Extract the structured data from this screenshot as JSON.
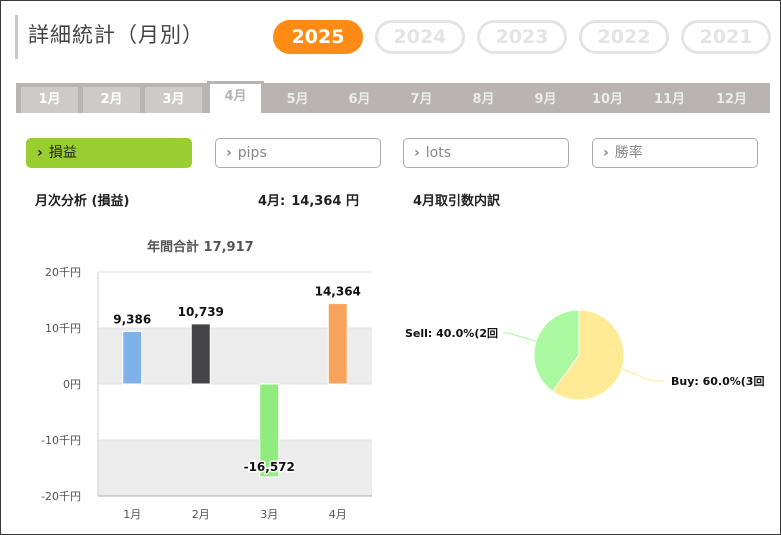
{
  "header": {
    "title": "詳細統計（月別）",
    "years": [
      "2025",
      "2024",
      "2023",
      "2022",
      "2021"
    ],
    "active_year": "2025"
  },
  "months": [
    "1月",
    "2月",
    "3月",
    "4月",
    "5月",
    "6月",
    "7月",
    "8月",
    "9月",
    "10月",
    "11月",
    "12月"
  ],
  "active_month_index": 3,
  "metrics": [
    {
      "label": "損益",
      "active": true
    },
    {
      "label": "pips",
      "active": false
    },
    {
      "label": "lots",
      "active": false
    },
    {
      "label": "勝率",
      "active": false
    }
  ],
  "metric_chevron": "›",
  "left_panel": {
    "heading": "月次分析 (損益)",
    "month_label": "4月:",
    "month_amount": "14,364 円",
    "annual_label": "年間合計 17,917"
  },
  "right_panel": {
    "heading": "4月取引数内訳"
  },
  "chart_data": [
    {
      "type": "bar",
      "title": "年間合計 17,917",
      "categories": [
        "1月",
        "2月",
        "3月",
        "4月"
      ],
      "values": [
        9386,
        10739,
        -16572,
        14364
      ],
      "value_labels": [
        "9,386",
        "10,739",
        "-16,572",
        "14,364"
      ],
      "colors": [
        "#7db3ea",
        "#434348",
        "#90ed7d",
        "#f7a35c"
      ],
      "ylim": [
        -20000,
        20000
      ],
      "yticks": [
        20000,
        10000,
        0,
        -10000,
        -20000
      ],
      "ytick_labels": [
        "20千円",
        "10千円",
        "0円",
        "-10千円",
        "-20千円"
      ],
      "band_fill": "#ececec"
    },
    {
      "type": "pie",
      "slices": [
        {
          "label": "Sell: 40.0%(2回",
          "value": 40.0,
          "color": "#aaf8a0",
          "line_color": "#aaf8a0"
        },
        {
          "label": "Buy: 60.0%(3回",
          "value": 60.0,
          "color": "#ffea96",
          "line_color": "#ffea96"
        }
      ]
    }
  ]
}
